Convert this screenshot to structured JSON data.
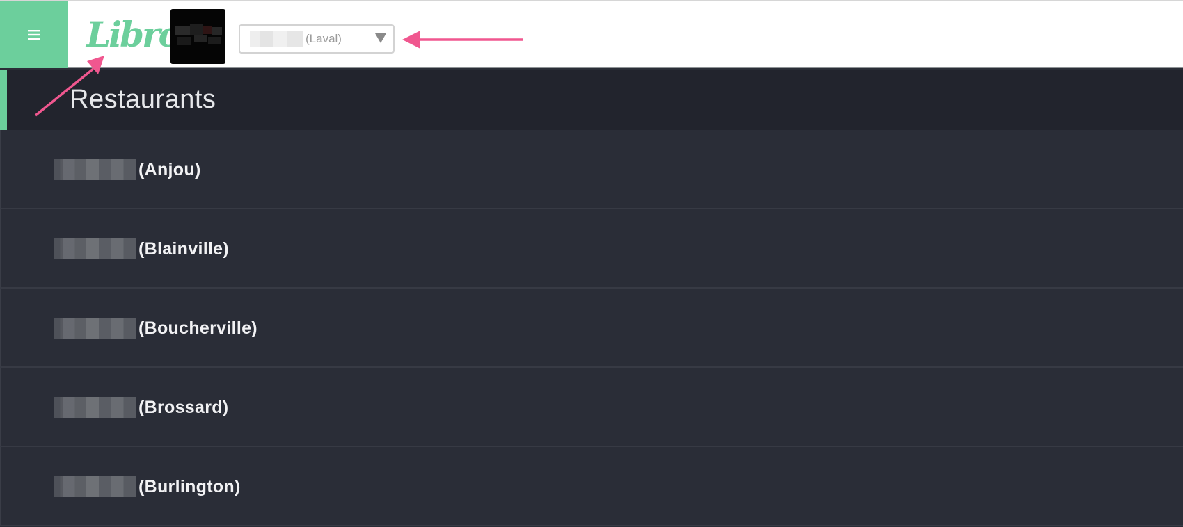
{
  "header": {
    "logo_text": "Libro",
    "selector": {
      "selected_suffix": "(Laval)"
    }
  },
  "section": {
    "title": "Restaurants"
  },
  "restaurants": [
    {
      "suffix": "(Anjou)"
    },
    {
      "suffix": "(Blainville)"
    },
    {
      "suffix": "(Boucherville)"
    },
    {
      "suffix": "(Brossard)"
    },
    {
      "suffix": "(Burlington)"
    }
  ],
  "colors": {
    "accent": "#6ccf9c",
    "annotation_arrow": "#f0578f",
    "header_dark": "#22242d",
    "list_bg": "#2a2d37"
  },
  "icons": {
    "menu": "hamburger-icon",
    "caret": "caret-down-icon"
  }
}
